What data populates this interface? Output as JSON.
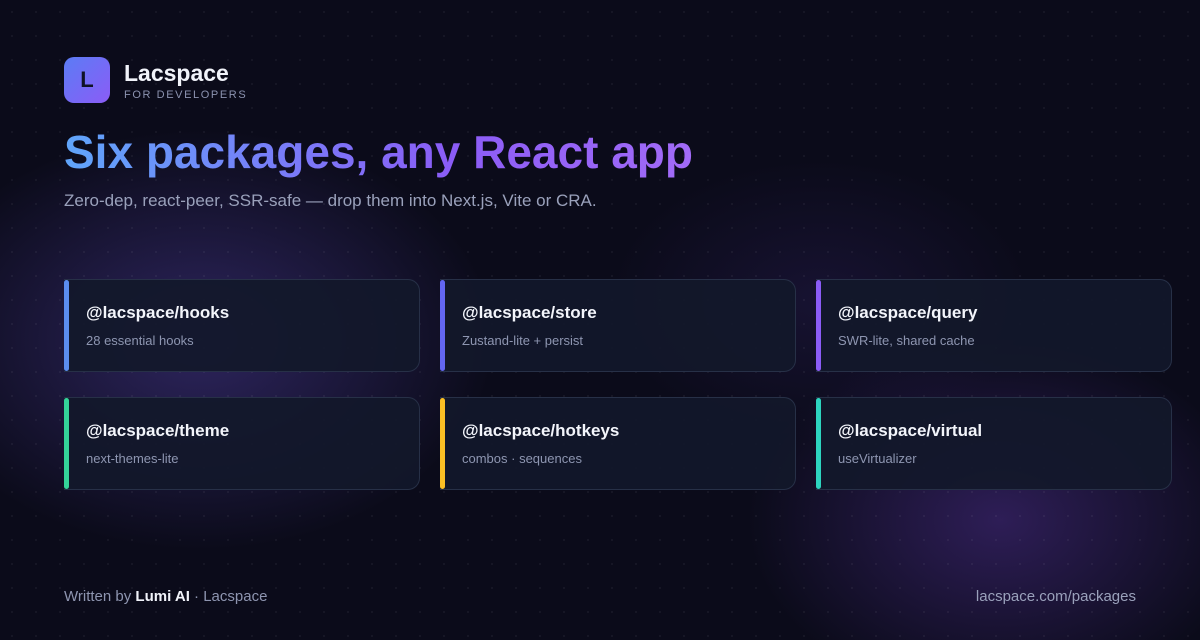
{
  "brand": {
    "logo_letter": "L",
    "name": "Lacspace",
    "tagline": "FOR DEVELOPERS",
    "gradient": [
      "#5b7cf5",
      "#8b5cf6"
    ]
  },
  "hero": {
    "title": "Six packages, any React app",
    "subtitle": "Zero-dep, react-peer, SSR-safe — drop them into Next.js, Vite or CRA."
  },
  "packages": [
    {
      "name": "@lacspace/hooks",
      "description": "28 essential hooks",
      "accent": "#5b8def"
    },
    {
      "name": "@lacspace/store",
      "description": "Zustand-lite + persist",
      "accent": "#6366f1"
    },
    {
      "name": "@lacspace/query",
      "description": "SWR-lite, shared cache",
      "accent": "#8b5cf6"
    },
    {
      "name": "@lacspace/theme",
      "description": "next-themes-lite",
      "accent": "#34d399"
    },
    {
      "name": "@lacspace/hotkeys",
      "description": "combos · sequences",
      "accent": "#fbbf24"
    },
    {
      "name": "@lacspace/virtual",
      "description": "useVirtualizer",
      "accent": "#2dd4bf"
    }
  ],
  "footer": {
    "written_by_prefix": "Written by",
    "author": "Lumi AI",
    "separator": "·",
    "org": "Lacspace",
    "link": "lacspace.com/packages"
  }
}
